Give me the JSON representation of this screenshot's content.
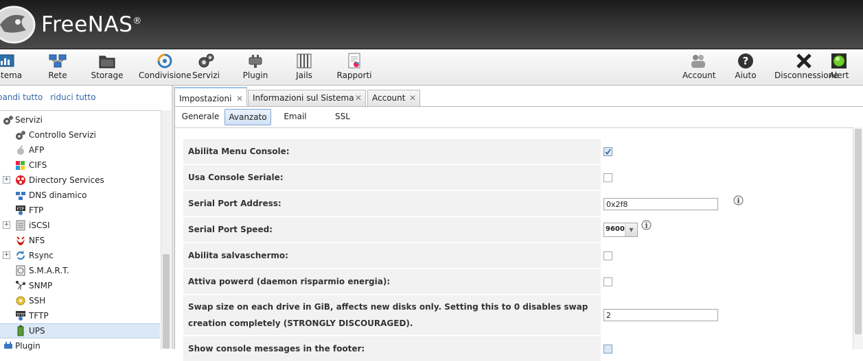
{
  "header": {
    "logo_text": "FreeNAS",
    "logo_mark": "®"
  },
  "toolbar": {
    "left": [
      {
        "label": "Sistema",
        "icon": "system-icon"
      },
      {
        "label": "Rete",
        "icon": "network-icon"
      },
      {
        "label": "Storage",
        "icon": "storage-icon"
      },
      {
        "label": "Condivisione",
        "icon": "sharing-icon"
      },
      {
        "label": "Servizi",
        "icon": "services-icon"
      },
      {
        "label": "Plugin",
        "icon": "plugin-icon"
      },
      {
        "label": "Jails",
        "icon": "jails-icon"
      },
      {
        "label": "Rapporti",
        "icon": "reports-icon"
      }
    ],
    "right": [
      {
        "label": "Account",
        "icon": "account-icon"
      },
      {
        "label": "Aiuto",
        "icon": "help-icon"
      },
      {
        "label": "Disconnessione",
        "icon": "logout-icon"
      },
      {
        "label": "Alert",
        "icon": "alert-icon"
      }
    ]
  },
  "tree_controls": {
    "expand_all": "Espandi tutto",
    "collapse_all": "riduci tutto"
  },
  "tree": [
    {
      "label": "Servizi",
      "icon": "services-gear-icon",
      "level": 0,
      "expander": ""
    },
    {
      "label": "Controllo Servizi",
      "icon": "gear-icon",
      "level": 1,
      "expander": ""
    },
    {
      "label": "AFP",
      "icon": "apple-icon",
      "level": 1,
      "expander": ""
    },
    {
      "label": "CIFS",
      "icon": "windows-icon",
      "level": 1,
      "expander": ""
    },
    {
      "label": "Directory Services",
      "icon": "directory-icon",
      "level": 1,
      "expander": "+"
    },
    {
      "label": "DNS dinamico",
      "icon": "dns-icon",
      "level": 1,
      "expander": ""
    },
    {
      "label": "FTP",
      "icon": "ftp-icon",
      "level": 1,
      "expander": ""
    },
    {
      "label": "iSCSI",
      "icon": "iscsi-icon",
      "level": 1,
      "expander": "+"
    },
    {
      "label": "NFS",
      "icon": "nfs-icon",
      "level": 1,
      "expander": ""
    },
    {
      "label": "Rsync",
      "icon": "rsync-icon",
      "level": 1,
      "expander": "+"
    },
    {
      "label": "S.M.A.R.T.",
      "icon": "smart-icon",
      "level": 1,
      "expander": ""
    },
    {
      "label": "SNMP",
      "icon": "snmp-icon",
      "level": 1,
      "expander": ""
    },
    {
      "label": "SSH",
      "icon": "ssh-icon",
      "level": 1,
      "expander": ""
    },
    {
      "label": "TFTP",
      "icon": "tftp-icon",
      "level": 1,
      "expander": ""
    },
    {
      "label": "UPS",
      "icon": "ups-icon",
      "level": 1,
      "expander": "",
      "selected": true
    },
    {
      "label": "Plugin",
      "icon": "plugin-small-icon",
      "level": 0,
      "expander": ""
    }
  ],
  "tabs": [
    {
      "label": "Impostazioni",
      "active": true
    },
    {
      "label": "Informazioni sul Sistema",
      "active": false
    },
    {
      "label": "Account",
      "active": false
    }
  ],
  "subtabs": [
    {
      "label": "Generale",
      "active": false
    },
    {
      "label": "Avanzato",
      "active": true
    },
    {
      "label": "Email",
      "active": false
    },
    {
      "label": "SSL",
      "active": false
    }
  ],
  "form": {
    "console_menu": {
      "label": "Abilita Menu Console:",
      "checked": true
    },
    "serial_console": {
      "label": "Usa Console Seriale:",
      "checked": false
    },
    "serial_port_address": {
      "label": "Serial Port Address:",
      "value": "0x2f8"
    },
    "serial_port_speed": {
      "label": "Serial Port Speed:",
      "value": "9600"
    },
    "screensaver": {
      "label": "Abilita salvaschermo:",
      "checked": false
    },
    "powerd": {
      "label": "Attiva powerd (daemon risparmio energia):",
      "checked": false
    },
    "swap_size": {
      "label_line1": "Swap size on each drive in GiB, affects new disks only. Setting this to 0 disables swap",
      "label_line2": "creation completely (STRONGLY DISCOURAGED).",
      "value": "2"
    },
    "console_messages": {
      "label": "Show console messages in the footer:",
      "checked": true
    }
  },
  "colors": {
    "header_bg": "#2c2c2c",
    "selection": "#dbe8f6",
    "link": "#3366aa"
  }
}
